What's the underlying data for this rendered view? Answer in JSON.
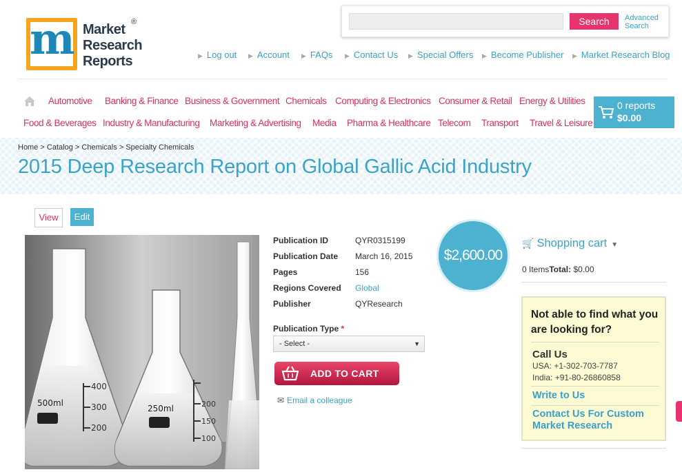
{
  "logo": {
    "line1": "Market",
    "line2": "Research",
    "line3": "Reports",
    "reg": "®"
  },
  "search": {
    "placeholder": "",
    "button": "Search",
    "advanced_line1": "Advanced",
    "advanced_line2": "Search"
  },
  "toplinks": [
    "Log out",
    "Account",
    "FAQs",
    "Contact Us",
    "Special Offers",
    "Become Publisher",
    "Market Research Blog"
  ],
  "nav_row1": [
    "Automotive",
    "Banking & Finance",
    "Business & Government",
    "Chemicals",
    "Computing & Electronics",
    "Consumer & Retail",
    "Energy & Utilities"
  ],
  "nav_row2": [
    "Food & Beverages",
    "Industry & Manufacturing",
    "Marketing & Advertising",
    "Media",
    "Pharma & Healthcare",
    "Telecom",
    "Transport",
    "Travel & Leisure"
  ],
  "cart": {
    "count": "0 reports",
    "total": "$0.00"
  },
  "breadcrumb": [
    "Home",
    "Catalog",
    "Chemicals",
    "Specialty Chemicals"
  ],
  "breadcrumb_sep": ">",
  "page_title": "2015 Deep Research Report on Global Gallic Acid Industry",
  "tabs": {
    "view": "View",
    "edit": "Edit"
  },
  "details": [
    {
      "label": "Publication ID",
      "value": "QYR0315199"
    },
    {
      "label": "Publication Date",
      "value": "March 16, 2015"
    },
    {
      "label": "Pages",
      "value": "156"
    },
    {
      "label": "Regions Covered",
      "value": "Global"
    },
    {
      "label": "Publisher",
      "value": "QYResearch"
    }
  ],
  "publication_type": {
    "label": "Publication Type",
    "required": "*",
    "selected": "- Select -"
  },
  "add_to_cart": "ADD TO CART",
  "email_colleague": "Email a colleague",
  "price": "$2,600.00",
  "image_labels": {
    "left_volume": "500ml",
    "mid_volume": "250ml",
    "ticks_left": [
      "400",
      "300",
      "200"
    ],
    "ticks_mid": [
      "200",
      "150",
      "100"
    ]
  },
  "sidebar": {
    "cart_title": "Shopping cart",
    "items_text": "0 Items",
    "total_label": "Total:",
    "total_value": "$0.00",
    "help_question": "Not able to find what you are looking for?",
    "call_us": "Call Us",
    "phone_usa": "USA: +1-302-703-7787",
    "phone_india": "India: +91-80-26860858",
    "write_to_us": "Write to Us",
    "contact_custom": "Contact Us For Custom Market Research"
  },
  "colors": {
    "accent_blue": "#4cb2cf",
    "accent_pink": "#e8346d",
    "nav_pink": "#d83060",
    "logo_orange": "#f4a51d"
  }
}
